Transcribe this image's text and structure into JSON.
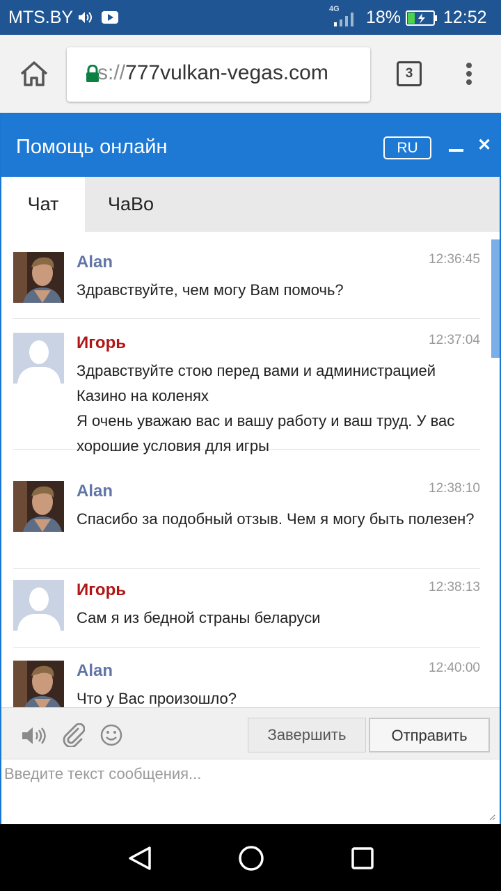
{
  "status_bar": {
    "carrier": "MTS.BY",
    "network": "4G",
    "battery": "18%",
    "time": "12:52",
    "icons": [
      "volume-icon",
      "youtube-icon",
      "signal-icon",
      "battery-charging-icon"
    ]
  },
  "browser": {
    "url_scheme": "s://",
    "url_host": "777vulkan-vegas.com",
    "tabs_count": "3",
    "icons": [
      "home-icon",
      "lock-icon",
      "tabs-icon",
      "overflow-menu-icon"
    ]
  },
  "chat": {
    "title": "Помощь онлайн",
    "language": "RU",
    "tabs": [
      {
        "label": "Чат",
        "active": true
      },
      {
        "label": "ЧаВо",
        "active": false
      }
    ],
    "messages": [
      {
        "author": "Alan",
        "role": "agent",
        "time": "12:36:45",
        "text": "Здравствуйте, чем могу Вам помочь?"
      },
      {
        "author": "Игорь",
        "role": "visitor",
        "time": "12:37:04",
        "text": "Здравствуйте стою перед вами и администрацией Казино на коленях\nЯ очень уважаю вас и вашу работу и ваш труд. У вас хорошие условия для игры"
      },
      {
        "author": "Alan",
        "role": "agent",
        "time": "12:38:10",
        "text": "Спасибо за подобный отзыв. Чем я могу быть полезен?"
      },
      {
        "author": "Игорь",
        "role": "visitor",
        "time": "12:38:13",
        "text": "Сам я из бедной страны беларуси"
      },
      {
        "author": "Alan",
        "role": "agent",
        "time": "12:40:00",
        "text": "Что у Вас произошло?"
      }
    ],
    "toolbar": {
      "icons": [
        "speaker-icon",
        "paperclip-icon",
        "smiley-icon"
      ],
      "end_label": "Завершить",
      "send_label": "Отправить"
    },
    "input_placeholder": "Введите текст сообщения...",
    "input_value": "",
    "colors": {
      "header": "#1e79d5",
      "agent_name": "#6176a6",
      "visitor_name": "#b01616"
    }
  },
  "nav_bar": {
    "icons": [
      "back-icon",
      "home-circle-icon",
      "recents-icon"
    ]
  }
}
